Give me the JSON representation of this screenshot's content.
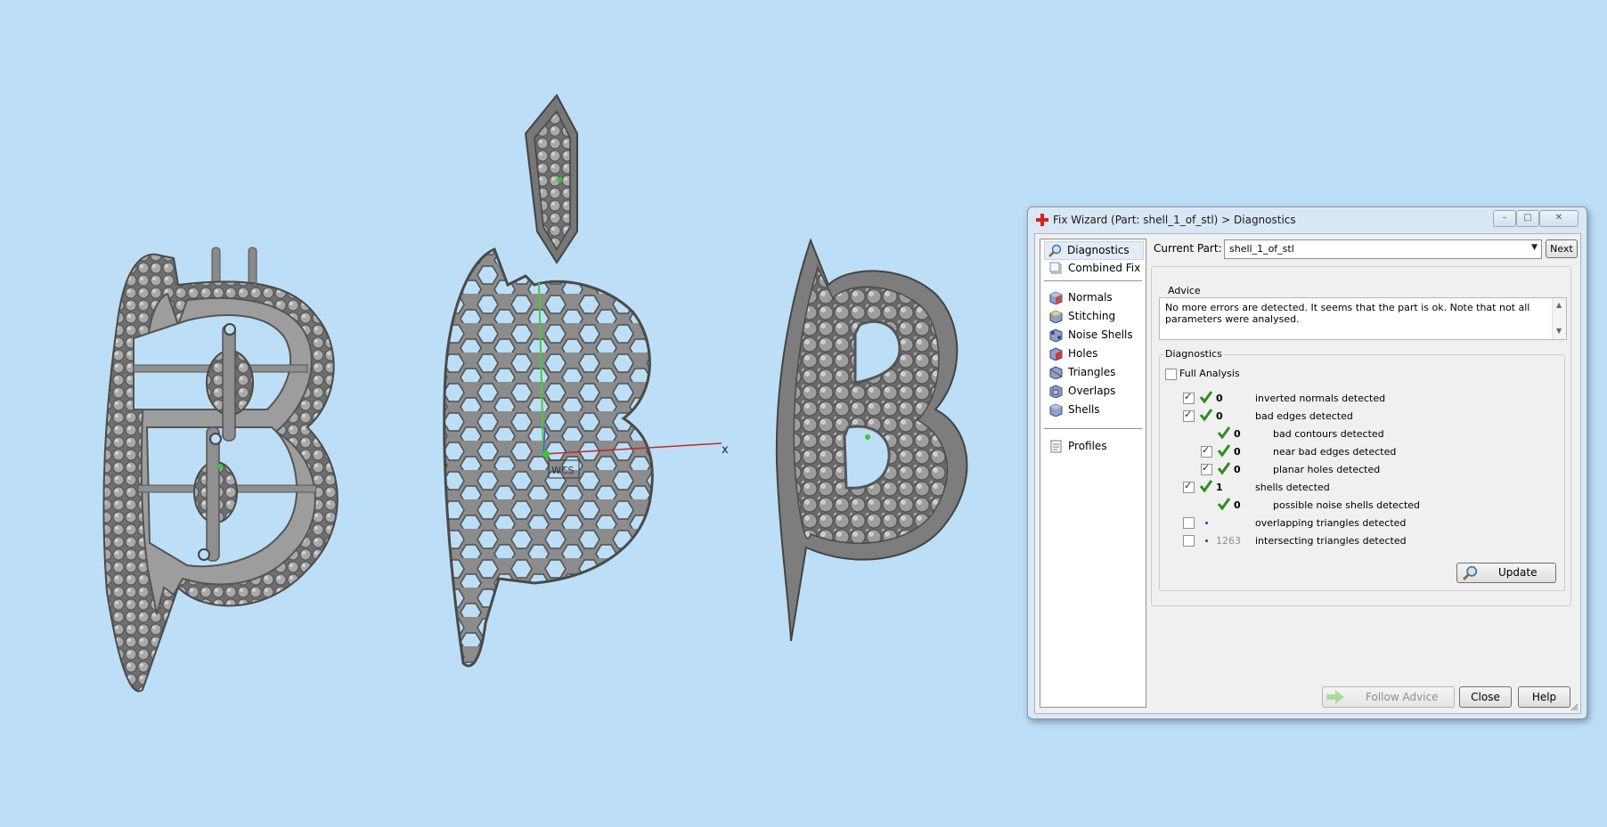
{
  "viewport": {
    "axis_x_label": "x",
    "wcs_label": "WCS"
  },
  "dialog": {
    "title": "Fix Wizard (Part: shell_1_of_stl) > Diagnostics",
    "nav": [
      {
        "label": "Diagnostics",
        "icon": "magnifier-icon",
        "selected": true
      },
      {
        "label": "Combined Fix",
        "icon": "combined-fix-icon"
      },
      {
        "label": "Normals",
        "icon": "normals-cube-icon"
      },
      {
        "label": "Stitching",
        "icon": "stitching-cube-icon"
      },
      {
        "label": "Noise Shells",
        "icon": "noise-shells-icon"
      },
      {
        "label": "Holes",
        "icon": "holes-cube-icon"
      },
      {
        "label": "Triangles",
        "icon": "triangles-cube-icon"
      },
      {
        "label": "Overlaps",
        "icon": "overlaps-cube-icon"
      },
      {
        "label": "Shells",
        "icon": "shells-cube-icon"
      },
      {
        "label": "Profiles",
        "icon": "profiles-document-icon"
      }
    ],
    "current_part_label": "Current Part:",
    "current_part_value": "shell_1_of_stl",
    "next_label": "Next",
    "advice_title": "Advice",
    "advice_text": "No more errors are detected. It seems that the part is ok. Note that not all parameters were analysed.",
    "diagnostics_title": "Diagnostics",
    "full_analysis_label": "Full Analysis",
    "full_analysis_checked": false,
    "rows": [
      {
        "checked": true,
        "status": "ok",
        "count": "0",
        "label": "inverted normals detected"
      },
      {
        "checked": true,
        "status": "ok",
        "count": "0",
        "label": "bad edges detected"
      },
      {
        "checked": null,
        "status": "ok",
        "count": "0",
        "label": "bad contours detected"
      },
      {
        "checked": true,
        "status": "ok",
        "count": "0",
        "label": "near bad edges detected"
      },
      {
        "checked": true,
        "status": "ok",
        "count": "0",
        "label": "planar holes detected"
      },
      {
        "checked": true,
        "status": "ok",
        "count": "1",
        "label": "shells detected"
      },
      {
        "checked": null,
        "status": "ok",
        "count": "0",
        "label": "possible noise shells detected"
      },
      {
        "checked": false,
        "status": "unknown",
        "count": "",
        "label": "overlapping triangles detected"
      },
      {
        "checked": false,
        "status": "unknown",
        "count": "1263",
        "label": "intersecting triangles detected"
      }
    ],
    "update_label": "Update",
    "follow_advice_label": "Follow Advice",
    "close_label": "Close",
    "help_label": "Help",
    "colors": {
      "accent_check": "#2e8b1e",
      "background": "#bcdff7"
    }
  }
}
